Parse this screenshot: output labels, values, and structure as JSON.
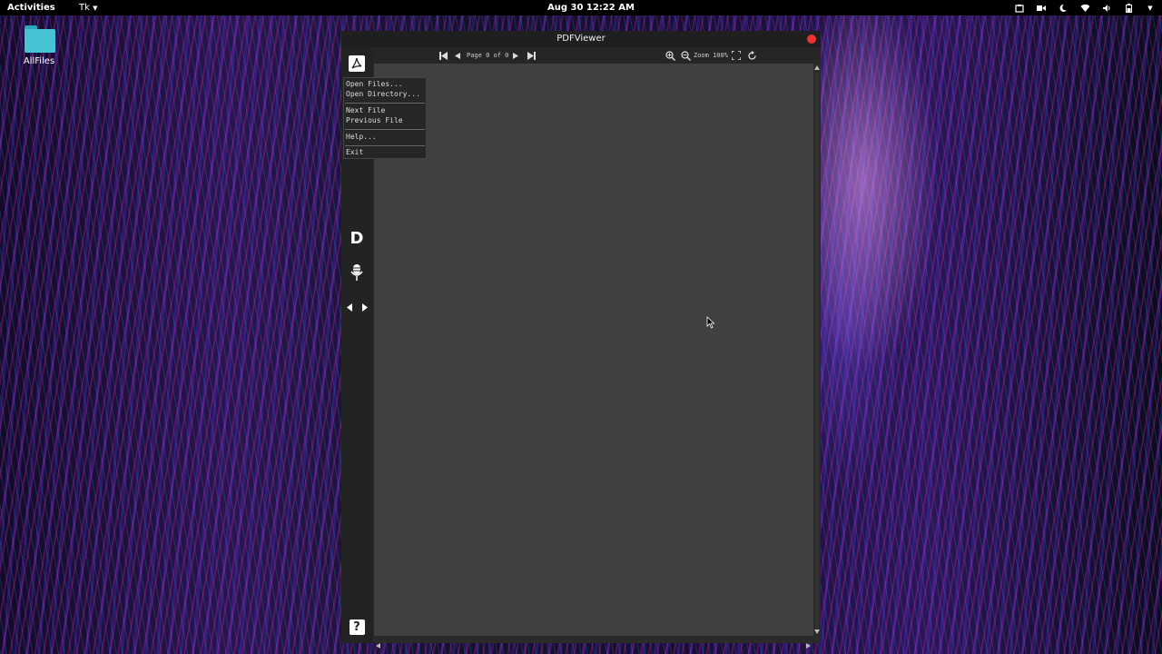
{
  "topbar": {
    "activities": "Activities",
    "app_menu": "Tk",
    "clock": "Aug 30  12:22 AM"
  },
  "desktop": {
    "icons": [
      {
        "label": "AllFiles"
      }
    ]
  },
  "window": {
    "title": "PDFViewer",
    "toolbar": {
      "page_label": "Page 0 of 0",
      "zoom_label": "Zoom 100%"
    },
    "sidebar": {
      "d_label": "D",
      "help_label": "?"
    },
    "menu": {
      "items": [
        "Open Files...",
        "Open Directory...",
        "Next File",
        "Previous File",
        "Help...",
        "Exit"
      ]
    }
  },
  "colors": {
    "close_button": "#ee3333",
    "canvas": "#404040",
    "folder": "#48c3d3"
  }
}
